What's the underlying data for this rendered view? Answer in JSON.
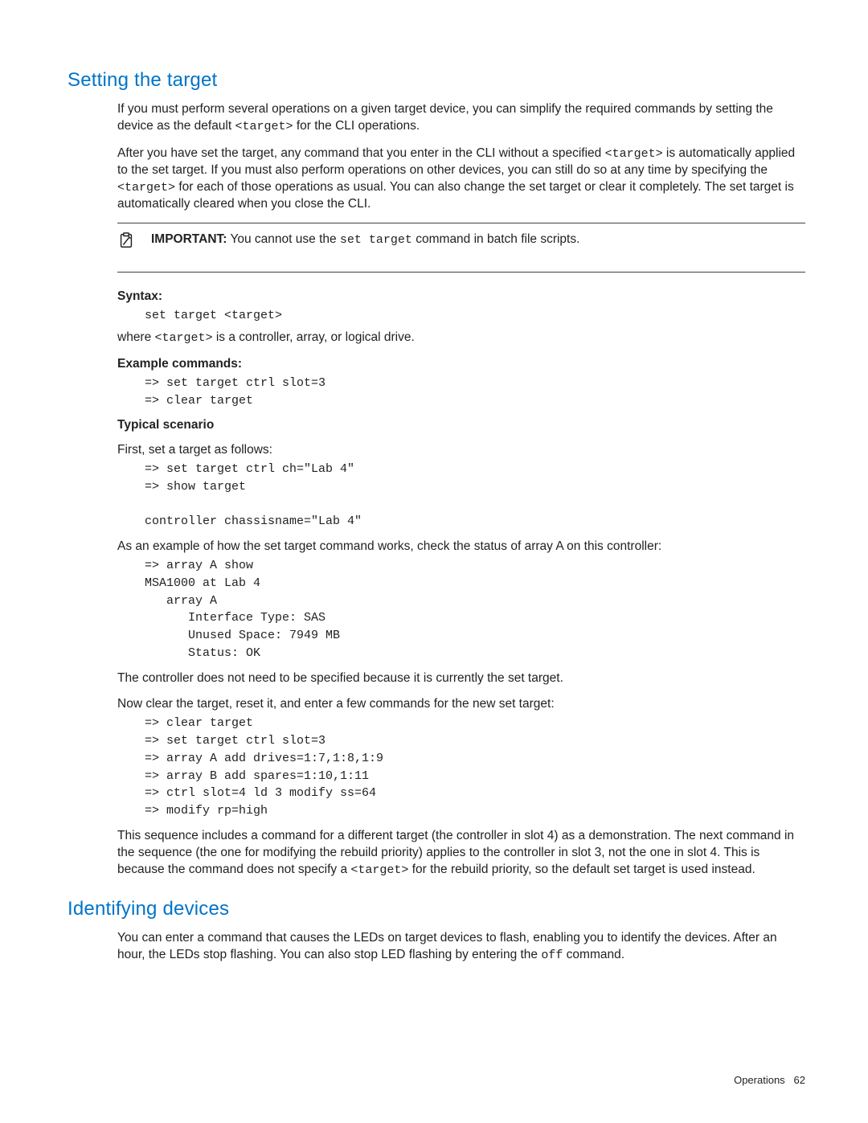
{
  "section1": {
    "heading": "Setting the target",
    "para1_a": "If you must perform several operations on a given target device, you can simplify the required commands by setting the device as the default ",
    "para1_code": "<target>",
    "para1_b": " for the CLI operations.",
    "para2_a": "After you have set the target, any command that you enter in the CLI without a specified ",
    "para2_code": "<target>",
    "para2_b": " is automatically applied to the set target. If you must also perform operations on other devices, you can still do so at any time by specifying the ",
    "para2_code2": "<target>",
    "para2_c": " for each of those operations as usual. You can also change the set target or clear it completely. The set target is automatically cleared when you close the CLI.",
    "important_label": "IMPORTANT:",
    "important_a": "   You cannot use the ",
    "important_code": "set target",
    "important_b": " command in batch file scripts.",
    "syntax_label": "Syntax:",
    "syntax_code": "set target <target>",
    "where_a": "where ",
    "where_code": "<target>",
    "where_b": " is a controller, array, or logical drive.",
    "example_label": "Example commands:",
    "example_code": "=> set target ctrl slot=3\n=> clear target",
    "typical_label": "Typical scenario",
    "typical_intro": "First, set a target as follows:",
    "typical_code1": "=> set target ctrl ch=\"Lab 4\"\n=> show target\n\ncontroller chassisname=\"Lab 4\"",
    "typical_check": "As an example of how the set target command works, check the status of array A on this controller:",
    "typical_code2": "=> array A show\nMSA1000 at Lab 4\n   array A\n      Interface Type: SAS\n      Unused Space: 7949 MB\n      Status: OK",
    "typical_note": "The controller does not need to be specified because it is currently the set target.",
    "typical_now": "Now clear the target, reset it, and enter a few commands for the new set target:",
    "typical_code3": "=> clear target\n=> set target ctrl slot=3\n=> array A add drives=1:7,1:8,1:9\n=> array B add spares=1:10,1:11\n=> ctrl slot=4 ld 3 modify ss=64\n=> modify rp=high",
    "typical_seq_a": "This sequence includes a command for a different target (the controller in slot 4) as a demonstration. The next command in the sequence (the one for modifying the rebuild priority) applies to the controller in slot 3, not the one in slot 4. This is because the command does not specify a ",
    "typical_seq_code": "<target>",
    "typical_seq_b": " for the rebuild priority, so the default set target is used instead."
  },
  "section2": {
    "heading": "Identifying devices",
    "para_a": "You can enter a command that causes the LEDs on target devices to flash, enabling you to identify the devices. After an hour, the LEDs stop flashing. You can also stop LED flashing by entering the ",
    "para_code": "off",
    "para_b": " command."
  },
  "footer": {
    "section": "Operations",
    "page": "62"
  }
}
